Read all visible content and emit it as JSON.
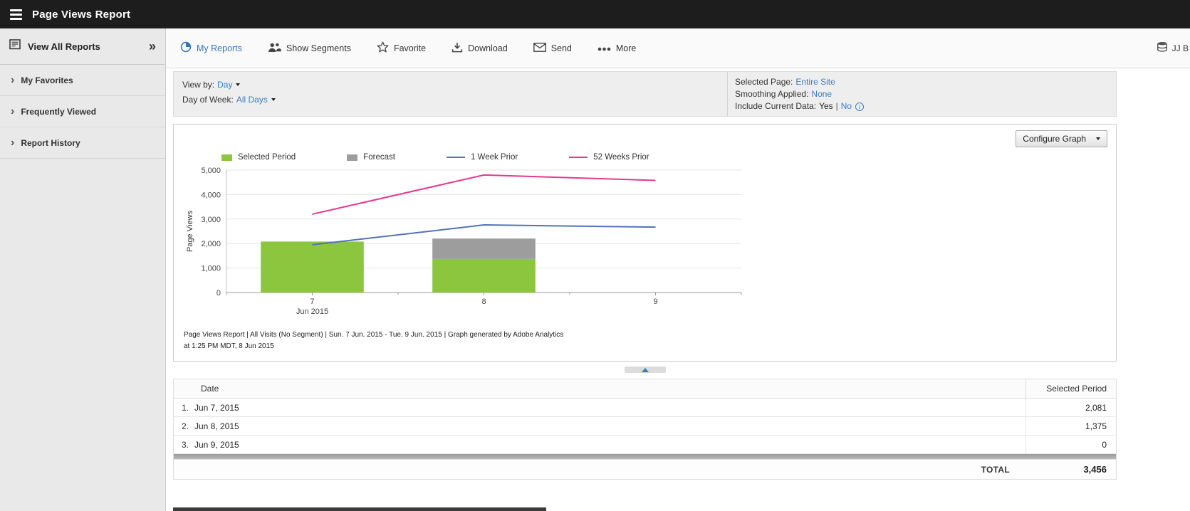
{
  "header": {
    "title": "Page Views Report"
  },
  "sidebar": {
    "view_all_reports": "View All Reports",
    "items": [
      {
        "label": "My Favorites"
      },
      {
        "label": "Frequently Viewed"
      },
      {
        "label": "Report History"
      }
    ]
  },
  "toolbar": {
    "my_reports": "My Reports",
    "show_segments": "Show Segments",
    "favorite": "Favorite",
    "download": "Download",
    "send": "Send",
    "more": "More",
    "user": "JJ B"
  },
  "filters": {
    "view_by_label": "View by:",
    "view_by_value": "Day",
    "day_of_week_label": "Day of Week:",
    "day_of_week_value": "All Days",
    "selected_page_label": "Selected Page:",
    "selected_page_value": "Entire Site",
    "smoothing_label": "Smoothing Applied:",
    "smoothing_value": "None",
    "include_current_label": "Include Current Data:",
    "include_current_yes": "Yes",
    "include_current_sep": "|",
    "include_current_no": "No"
  },
  "graph": {
    "configure_button": "Configure Graph",
    "caption_line1": "Page Views Report | All Visits (No Segment) | Sun. 7 Jun. 2015 - Tue. 9 Jun. 2015 | Graph generated by Adobe Analytics",
    "caption_line2": "at 1:25 PM MDT, 8 Jun 2015"
  },
  "chart_data": {
    "type": "bar",
    "categories": [
      "7",
      "8",
      "9"
    ],
    "category_sub_label": "Jun 2015",
    "xlabel": "",
    "ylabel": "Page Views",
    "ylim": [
      0,
      5000
    ],
    "ytick_values": [
      0,
      1000,
      2000,
      3000,
      4000,
      5000
    ],
    "ytick_labels": [
      "0",
      "1,000",
      "2,000",
      "3,000",
      "4,000",
      "5,000"
    ],
    "grid": true,
    "legend_position": "top",
    "series": [
      {
        "name": "Selected Period",
        "kind": "bar",
        "color": "#8cc63e",
        "values": [
          2081,
          1375,
          0
        ]
      },
      {
        "name": "Forecast",
        "kind": "bar-stack",
        "color": "#9d9d9d",
        "values": [
          0,
          830,
          0
        ]
      },
      {
        "name": "1 Week Prior",
        "kind": "line",
        "color": "#5273b8",
        "values": [
          1950,
          2760,
          2670
        ]
      },
      {
        "name": "52 Weeks Prior",
        "kind": "line",
        "color": "#e8378f",
        "values": [
          3200,
          4800,
          4580
        ]
      }
    ]
  },
  "table": {
    "date_header": "Date",
    "value_header": "Selected Period",
    "rows": [
      {
        "num": "1.",
        "date": "Jun 7, 2015",
        "value": "2,081"
      },
      {
        "num": "2.",
        "date": "Jun 8, 2015",
        "value": "1,375"
      },
      {
        "num": "3.",
        "date": "Jun 9, 2015",
        "value": "0"
      }
    ],
    "total_label": "TOTAL",
    "total_value": "3,456"
  }
}
